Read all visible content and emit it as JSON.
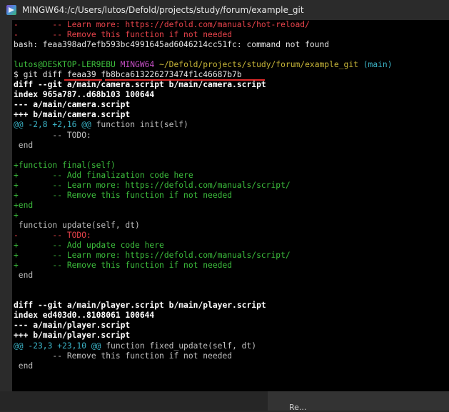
{
  "window": {
    "title": "MINGW64:/c/Users/lutos/Defold/projects/study/forum/example_git"
  },
  "bottom_panel": {
    "text": "Re..."
  },
  "terminal": {
    "lines": [
      [
        {
          "t": "-       -- Learn more: https://defold.com/manuals/hot-reload/",
          "c": "red"
        }
      ],
      [
        {
          "t": "-       -- Remove this function if not needed",
          "c": "red"
        }
      ],
      [
        {
          "t": "bash: feaa398ad7efb593bc4991645ad6046214cc51fc: command not found",
          "c": "white"
        }
      ],
      [
        {
          "t": "",
          "c": "plain"
        }
      ],
      [
        {
          "t": "lutos@DESKTOP-LER9EBU ",
          "c": "green"
        },
        {
          "t": "MINGW64 ",
          "c": "mag"
        },
        {
          "t": "~/Defold/projects/study/forum/example_git",
          "c": "yel"
        },
        {
          "t": " (main)",
          "c": "cyan"
        }
      ],
      [
        {
          "t": "$ git diff feaa39 fb8bca613226273474f1c46687b7b",
          "c": "white"
        }
      ],
      [
        {
          "t": "diff --git a/main/camera.script b/main/camera.script",
          "c": "bold"
        }
      ],
      [
        {
          "t": "index 965a787..d68b103 100644",
          "c": "bold"
        }
      ],
      [
        {
          "t": "--- a/main/camera.script",
          "c": "bold"
        }
      ],
      [
        {
          "t": "+++ b/main/camera.script",
          "c": "bold"
        }
      ],
      [
        {
          "t": "@@ -2,8 +2,16 @@",
          "c": "cyan"
        },
        {
          "t": " function init(self)",
          "c": "plain"
        }
      ],
      [
        {
          "t": "        -- TODO:",
          "c": "plain"
        }
      ],
      [
        {
          "t": " end",
          "c": "plain"
        }
      ],
      [
        {
          "t": "",
          "c": "plain"
        }
      ],
      [
        {
          "t": "+function final(self)",
          "c": "green"
        }
      ],
      [
        {
          "t": "+       -- Add finalization code here",
          "c": "green"
        }
      ],
      [
        {
          "t": "+       -- Learn more: https://defold.com/manuals/script/",
          "c": "green"
        }
      ],
      [
        {
          "t": "+       -- Remove this function if not needed",
          "c": "green"
        }
      ],
      [
        {
          "t": "+end",
          "c": "green"
        }
      ],
      [
        {
          "t": "+",
          "c": "green"
        }
      ],
      [
        {
          "t": " function update(self, dt)",
          "c": "plain"
        }
      ],
      [
        {
          "t": "-       -- TODO:",
          "c": "red"
        }
      ],
      [
        {
          "t": "+       -- Add update code here",
          "c": "green"
        }
      ],
      [
        {
          "t": "+       -- Learn more: https://defold.com/manuals/script/",
          "c": "green"
        }
      ],
      [
        {
          "t": "+       -- Remove this function if not needed",
          "c": "green"
        }
      ],
      [
        {
          "t": " end",
          "c": "plain"
        }
      ],
      [
        {
          "t": "",
          "c": "plain"
        }
      ],
      [
        {
          "t": "",
          "c": "plain"
        }
      ],
      [
        {
          "t": "diff --git a/main/player.script b/main/player.script",
          "c": "bold"
        }
      ],
      [
        {
          "t": "index ed403d0..8108061 100644",
          "c": "bold"
        }
      ],
      [
        {
          "t": "--- a/main/player.script",
          "c": "bold"
        }
      ],
      [
        {
          "t": "+++ b/main/player.script",
          "c": "bold"
        }
      ],
      [
        {
          "t": "@@ -23,3 +23,10 @@",
          "c": "cyan"
        },
        {
          "t": " function fixed_update(self, dt)",
          "c": "plain"
        }
      ],
      [
        {
          "t": "        -- Remove this function if not needed",
          "c": "plain"
        }
      ],
      [
        {
          "t": " end",
          "c": "plain"
        }
      ],
      [
        {
          "t": "",
          "c": "plain"
        }
      ],
      [
        {
          "t": "",
          "c": "plain"
        }
      ],
      [
        {
          "t": "+",
          "c": "green"
        }
      ]
    ]
  }
}
